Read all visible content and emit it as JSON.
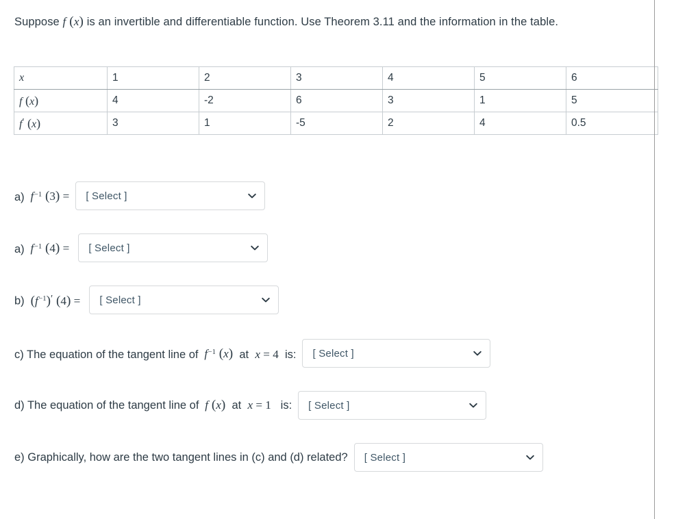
{
  "prompt": {
    "before_f": "Suppose ",
    "after_f": " is an invertible and differentiable function. Use Theorem 3.11 and the information in the table."
  },
  "table": {
    "rows": [
      {
        "head": "x",
        "head_kind": "x",
        "cells": [
          "1",
          "2",
          "3",
          "4",
          "5",
          "6"
        ]
      },
      {
        "head": "f (x)",
        "head_kind": "f",
        "cells": [
          "4",
          "-2",
          "6",
          "3",
          "1",
          "5"
        ]
      },
      {
        "head": "f' (x)",
        "head_kind": "fprime",
        "cells": [
          "3",
          "1",
          "-5",
          "2",
          "4",
          "0.5"
        ]
      }
    ]
  },
  "questions": [
    {
      "id": "a1",
      "prefix": "a)",
      "math": "f^{-1} (3) =",
      "suffix": "",
      "select_label": "[ Select ]"
    },
    {
      "id": "a2",
      "prefix": "a)",
      "math": "f^{-1} (4) =",
      "suffix": "",
      "select_label": "[ Select ]"
    },
    {
      "id": "b",
      "prefix": "b)",
      "math": "(f^{-1})' (4) =",
      "suffix": "",
      "select_label": "[ Select ]"
    },
    {
      "id": "c",
      "prefix": "c) The equation of the tangent line of",
      "math": "f^{-1} (x)",
      "mid": "at",
      "math2": "x = 4",
      "suffix": "is:",
      "select_label": "[ Select ]"
    },
    {
      "id": "d",
      "prefix": "d) The equation of the tangent line of",
      "math": "f (x)",
      "mid": "at",
      "math2": "x = 1",
      "suffix": "is:",
      "select_label": "[ Select ]"
    },
    {
      "id": "e",
      "prefix": "e) Graphically, how are the two tangent lines in (c) and (d) related?",
      "math": "",
      "suffix": "",
      "select_label": "[ Select ]"
    }
  ],
  "colors": {
    "text": "#2d3b45",
    "select_text": "#3f5666",
    "select_border": "#d6d9db",
    "table_border": "#c7cdd1",
    "divider": "#9a9a9a"
  }
}
